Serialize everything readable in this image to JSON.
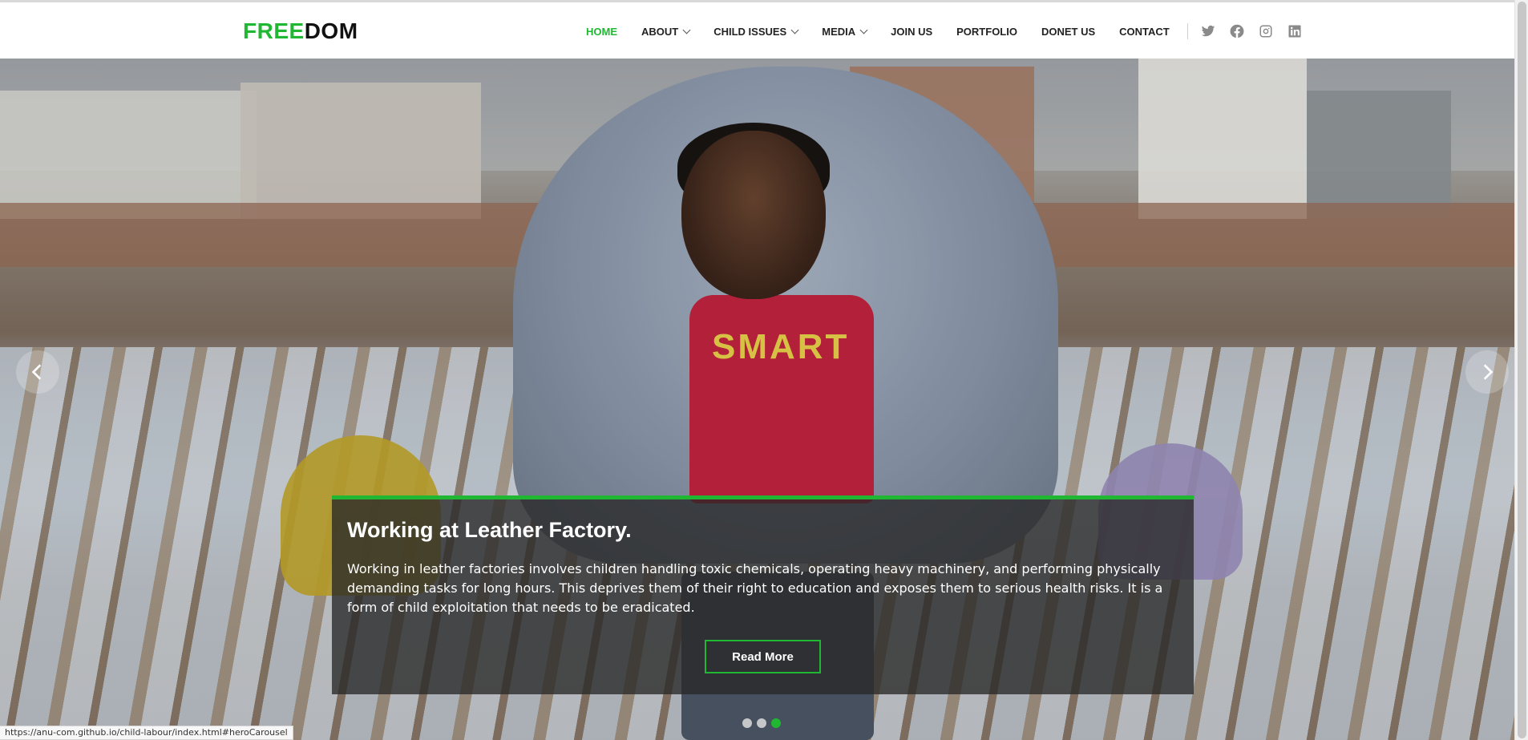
{
  "brand": {
    "part1": "FREE",
    "part2": "DOM"
  },
  "nav": {
    "items": [
      {
        "label": "HOME",
        "active": true,
        "dropdown": false
      },
      {
        "label": "ABOUT",
        "active": false,
        "dropdown": true
      },
      {
        "label": "CHILD ISSUES",
        "active": false,
        "dropdown": true
      },
      {
        "label": "MEDIA",
        "active": false,
        "dropdown": true
      },
      {
        "label": "JOIN US",
        "active": false,
        "dropdown": false
      },
      {
        "label": "PORTFOLIO",
        "active": false,
        "dropdown": false
      },
      {
        "label": "DONET US",
        "active": false,
        "dropdown": false
      },
      {
        "label": "CONTACT",
        "active": false,
        "dropdown": false
      }
    ],
    "social_icons": [
      "twitter-icon",
      "facebook-icon",
      "instagram-icon",
      "linkedin-icon"
    ]
  },
  "hero": {
    "shirt_text": "SMART",
    "caption_title": "Working at Leather Factory.",
    "caption_text": "Working in leather factories involves children handling toxic chemicals, operating heavy machinery, and performing physically demanding tasks for long hours. This deprives them of their right to education and exposes them to serious health risks. It is a form of child exploitation that needs to be eradicated.",
    "button_label": "Read More",
    "slide_count": 3,
    "active_slide": 3
  },
  "status_bar": {
    "url": "https://anu-com.github.io/child-labour/index.html#heroCarousel"
  },
  "colors": {
    "accent": "#20b832",
    "text": "#222222",
    "caption_bg": "#282828"
  }
}
